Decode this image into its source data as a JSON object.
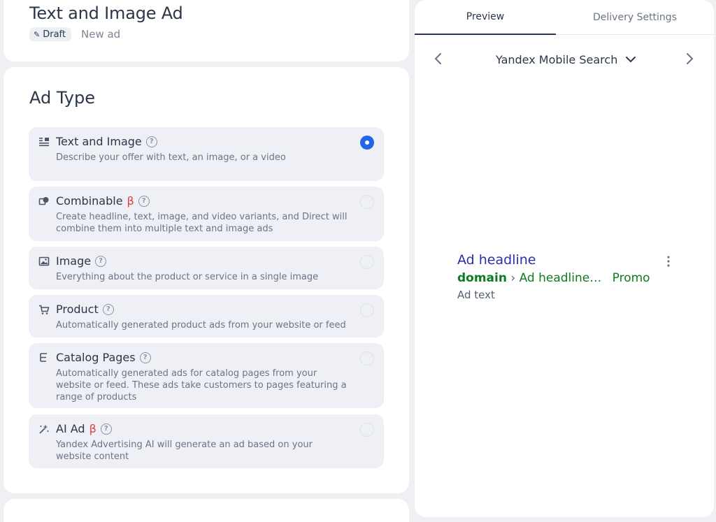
{
  "header": {
    "title": "Text and Image Ad",
    "status_chip": "Draft",
    "subtitle": "New ad"
  },
  "ad_type": {
    "section_title": "Ad Type",
    "options": [
      {
        "icon": "text-lines-icon",
        "title": "Text and Image",
        "beta": "",
        "description": "Describe your offer with text, an image, or a video",
        "selected": true
      },
      {
        "icon": "combine-shapes-icon",
        "title": "Combinable",
        "beta": "β",
        "description": "Create headline, text, image, and video variants, and Direct will combine them into multiple text and image ads",
        "selected": false
      },
      {
        "icon": "image-icon",
        "title": "Image",
        "beta": "",
        "description": "Everything about the product or service in a single image",
        "selected": false
      },
      {
        "icon": "cart-icon",
        "title": "Product",
        "beta": "",
        "description": "Automatically generated product ads from your website or feed",
        "selected": false
      },
      {
        "icon": "catalog-tree-icon",
        "title": "Catalog Pages",
        "beta": "",
        "description": "Automatically generated ads for catalog pages from your website or feed. These ads take customers to pages featuring a range of products",
        "selected": false
      },
      {
        "icon": "magic-sparkle-icon",
        "title": "AI Ad",
        "beta": "β",
        "description": "Yandex Advertising AI will generate an ad based on your website content",
        "selected": false
      }
    ]
  },
  "preview": {
    "tabs": [
      {
        "label": "Preview",
        "active": true
      },
      {
        "label": "Delivery Settings",
        "active": false
      }
    ],
    "device": "Yandex Mobile Search",
    "ad": {
      "headline": "Ad headline",
      "domain": "domain",
      "separator": "›",
      "path": "Ad headline…",
      "promo": "Promo",
      "text": "Ad text"
    }
  },
  "colors": {
    "accent": "#2563eb",
    "beta": "#e23b3b",
    "ad_headline": "#2a2fa8",
    "ad_url": "#0f7a1f"
  }
}
